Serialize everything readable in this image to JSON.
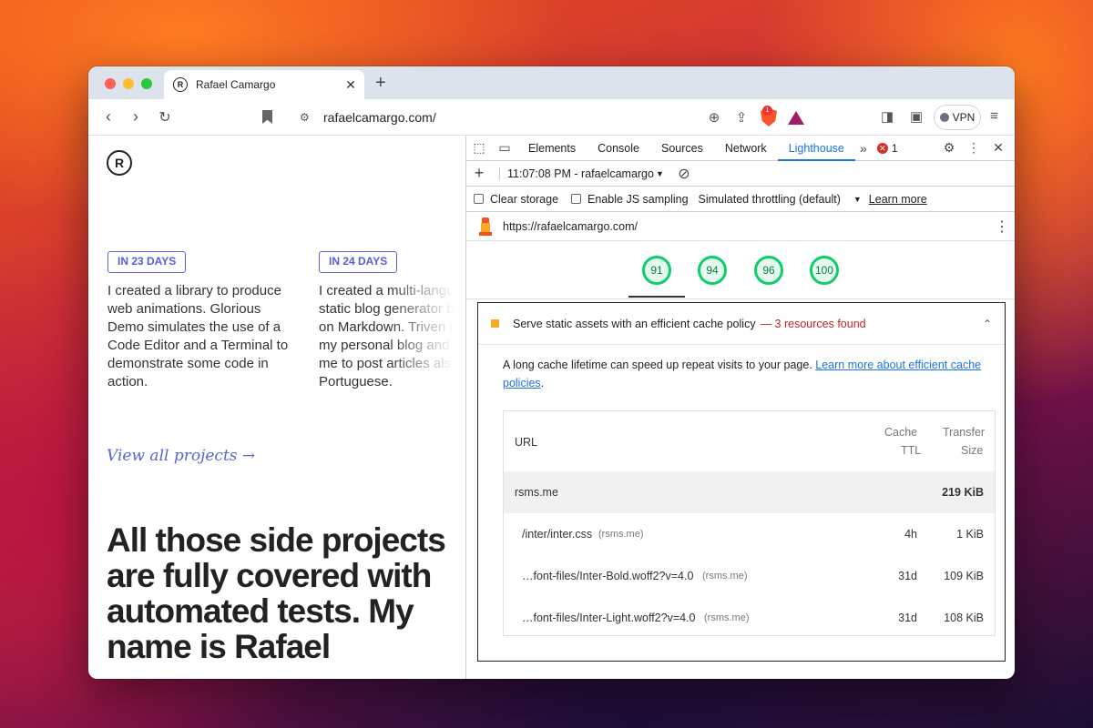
{
  "browser": {
    "tab_title": "Rafael Camargo",
    "tab_close": "✕",
    "new_tab": "+",
    "url": "rafaelcamargo.com/",
    "shield_count": "1",
    "vpn_label": "VPN"
  },
  "page": {
    "logo": "R",
    "projects": [
      {
        "badge": "IN 23 DAYS",
        "text": "I created a library to produce web animations. Glorious Demo simulates the use of a Code Editor and a Terminal to demonstrate some code in action."
      },
      {
        "badge": "IN 24 DAYS",
        "text": "I created a multi-language static blog generator based on Markdown. Triven powers my personal blog and allows me to post articles also in Portuguese."
      }
    ],
    "view_all": "View all projects →",
    "headline": "All those side projects are fully covered with automated tests. My name is Rafael"
  },
  "devtools": {
    "tabs": [
      "Elements",
      "Console",
      "Sources",
      "Network",
      "Lighthouse"
    ],
    "active_tab": "Lighthouse",
    "more_tabs": "»",
    "error_count": "1",
    "report_selector": "11:07:08 PM - rafaelcamargo",
    "clear_storage": "Clear storage",
    "enable_js_sampling": "Enable JS sampling",
    "throttling": "Simulated throttling (default)",
    "learn_more": "Learn more",
    "report_url": "https://rafaelcamargo.com/",
    "scores": [
      "91",
      "94",
      "96",
      "100"
    ],
    "audit": {
      "title": "Serve static assets with an efficient cache policy",
      "found": "— 3 resources found",
      "description": "A long cache lifetime can speed up repeat visits to your page.",
      "link": "Learn more about efficient cache policies",
      "link_end": ".",
      "table": {
        "headers": {
          "url": "URL",
          "cache_ttl_1": "Cache",
          "cache_ttl_2": "TTL",
          "transfer_1": "Transfer",
          "transfer_2": "Size"
        },
        "group": {
          "url": "rsms.me",
          "size": "219 KiB"
        },
        "rows": [
          {
            "url": "/inter/inter.css",
            "host": "(rsms.me)",
            "ttl": "4h",
            "size": "1 KiB"
          },
          {
            "url": "…font-files/Inter-Bold.woff2?v=4.0",
            "host": "(rsms.me)",
            "ttl": "31d",
            "size": "109 KiB"
          },
          {
            "url": "…font-files/Inter-Light.woff2?v=4.0",
            "host": "(rsms.me)",
            "ttl": "31d",
            "size": "108 KiB"
          }
        ]
      }
    }
  }
}
